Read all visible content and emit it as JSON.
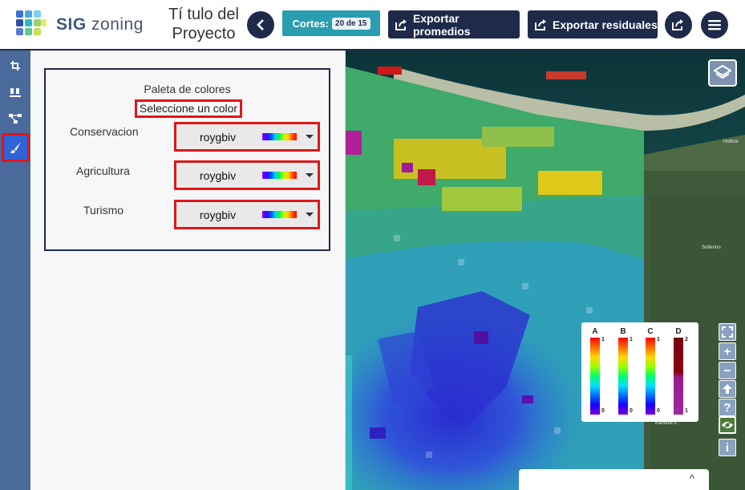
{
  "header": {
    "logo_text_bold": "SIG",
    "logo_text_rest": "zoning",
    "project_title": "Tí tulo del Proyecto",
    "cortes_label": "Cortes:",
    "cortes_badge": "20 de 15",
    "export_promedios": "Exportar promedios",
    "export_residuales": "Exportar residuales"
  },
  "toolbar": {
    "tools": [
      "crop-icon",
      "cups-icon",
      "network-icon",
      "paintbrush-icon"
    ],
    "active_tool": "paintbrush-icon"
  },
  "panel": {
    "title": "Paleta de colores",
    "hint": "Seleccione un color",
    "rows": [
      {
        "label": "Conservacion",
        "palette": "roygbiv"
      },
      {
        "label": "Agricultura",
        "palette": "roygbiv"
      },
      {
        "label": "Turismo",
        "palette": "roygbiv"
      }
    ]
  },
  "map": {
    "place_labels": [
      "Holbox",
      "Solferino",
      "Kantunil K."
    ],
    "legend": [
      {
        "letter": "A",
        "max": "1",
        "min": "0"
      },
      {
        "letter": "B",
        "max": "1",
        "min": "0"
      },
      {
        "letter": "C",
        "max": "1",
        "min": "0"
      },
      {
        "letter": "D",
        "max": "2",
        "min": "1"
      }
    ],
    "controls": [
      "fullscreen-icon",
      "zoom-in-icon",
      "zoom-out-icon",
      "north-arrow-icon",
      "help-icon",
      "visibility-icon",
      "info-icon"
    ],
    "controls_text": {
      "help": "?",
      "info": "i",
      "zoom_in": "+",
      "zoom_out": "−"
    },
    "bottom_tab_chevron": "^"
  },
  "colors": {
    "navy": "#1e2a4a",
    "teal": "#2a9db0",
    "toolbar": "#4a6a9c",
    "highlight": "#e01616",
    "active_tool": "#2f63d8"
  }
}
